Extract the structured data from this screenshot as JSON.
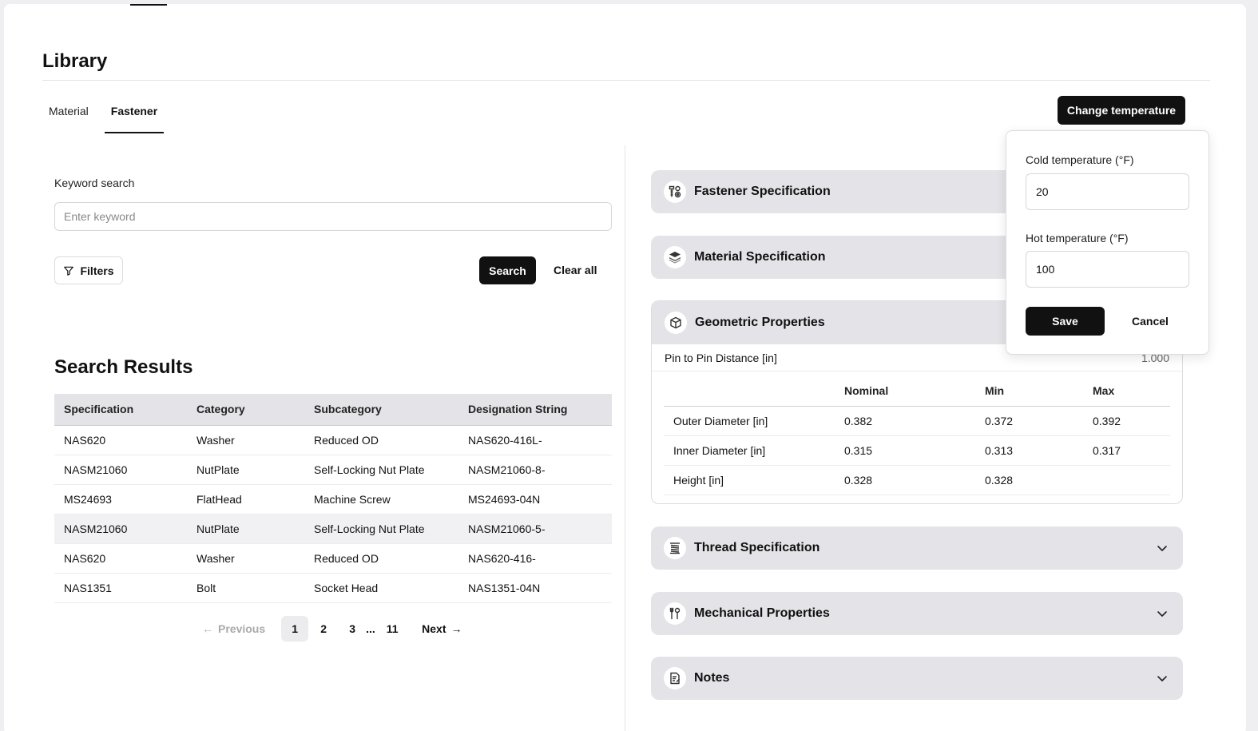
{
  "page": {
    "title": "Library"
  },
  "tabs": [
    {
      "label": "Material",
      "active": false
    },
    {
      "label": "Fastener",
      "active": true
    }
  ],
  "toolbar": {
    "change_temperature_label": "Change temperature"
  },
  "search": {
    "keyword_label": "Keyword search",
    "placeholder": "Enter keyword",
    "value": "",
    "filters_label": "Filters",
    "search_label": "Search",
    "clear_label": "Clear all"
  },
  "results": {
    "title": "Search Results",
    "columns": [
      "Specification",
      "Category",
      "Subcategory",
      "Designation String"
    ],
    "rows": [
      [
        "NAS620",
        "Washer",
        "Reduced OD",
        "NAS620-416L-"
      ],
      [
        "NASM21060",
        "NutPlate",
        "Self-Locking Nut Plate",
        "NASM21060-8-"
      ],
      [
        "MS24693",
        "FlatHead",
        "Machine Screw",
        "MS24693-04N"
      ],
      [
        "NASM21060",
        "NutPlate",
        "Self-Locking Nut Plate",
        "NASM21060-5-"
      ],
      [
        "NAS620",
        "Washer",
        "Reduced OD",
        "NAS620-416-"
      ],
      [
        "NAS1351",
        "Bolt",
        "Socket Head",
        "NAS1351-04N"
      ]
    ],
    "highlighted_row": 3
  },
  "pagination": {
    "previous_label": "Previous",
    "next_label": "Next",
    "pages": [
      "1",
      "2",
      "3"
    ],
    "ellipsis": "...",
    "last_page": "11",
    "current": "1"
  },
  "sections": {
    "fastener_spec": {
      "title": "Fastener Specification",
      "icon": "fastener-icon"
    },
    "material_spec": {
      "title": "Material Specification",
      "icon": "layers-icon"
    },
    "geometric": {
      "title": "Geometric Properties",
      "icon": "cube-icon",
      "pin_label": "Pin to Pin Distance [in]",
      "pin_value": "1.000",
      "columns": [
        "",
        "Nominal",
        "Min",
        "Max"
      ],
      "rows": [
        [
          "Outer Diameter [in]",
          "0.382",
          "0.372",
          "0.392"
        ],
        [
          "Inner Diameter [in]",
          "0.315",
          "0.313",
          "0.317"
        ],
        [
          "Height [in]",
          "0.328",
          "0.328",
          ""
        ]
      ]
    },
    "thread_spec": {
      "title": "Thread Specification",
      "icon": "thread-icon"
    },
    "mechanical": {
      "title": "Mechanical Properties",
      "icon": "tools-icon"
    },
    "notes": {
      "title": "Notes",
      "icon": "notes-icon"
    }
  },
  "temperature_popover": {
    "cold_label": "Cold temperature (°F)",
    "cold_value": "20",
    "hot_label": "Hot temperature (°F)",
    "hot_value": "100",
    "save_label": "Save",
    "cancel_label": "Cancel"
  },
  "colors": {
    "primary": "#111111",
    "accordion_bg": "#e4e4e8",
    "table_header_bg": "#e4e4e8",
    "highlight_row": "#f1f1f4",
    "page_bg": "#efeff1"
  }
}
